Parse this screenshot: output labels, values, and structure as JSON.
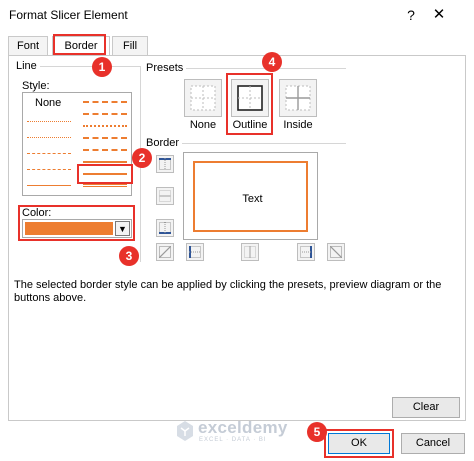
{
  "dialog": {
    "title": "Format Slicer Element",
    "help_glyph": "?",
    "close_glyph": "✕"
  },
  "tabs": [
    {
      "label": "Font"
    },
    {
      "label": "Border"
    },
    {
      "label": "Fill"
    }
  ],
  "line_group": {
    "label": "Line",
    "style_label": "Style:",
    "none_label": "None",
    "color_label": "Color:",
    "selected_color": "#ED7D31"
  },
  "presets_group": {
    "label": "Presets",
    "items": [
      {
        "label": "None"
      },
      {
        "label": "Outline"
      },
      {
        "label": "Inside"
      }
    ]
  },
  "border_group": {
    "label": "Border",
    "preview_text": "Text"
  },
  "description": "The selected border style can be applied by clicking the presets, preview diagram or the buttons above.",
  "buttons": {
    "clear": "Clear",
    "ok": "OK",
    "cancel": "Cancel"
  },
  "callouts": [
    "1",
    "2",
    "3",
    "4",
    "5"
  ],
  "watermark": {
    "name": "exceldemy",
    "tagline": "EXCEL · DATA · BI"
  },
  "colors": {
    "accent": "#ED7D31",
    "annotation": "#E8312A"
  }
}
